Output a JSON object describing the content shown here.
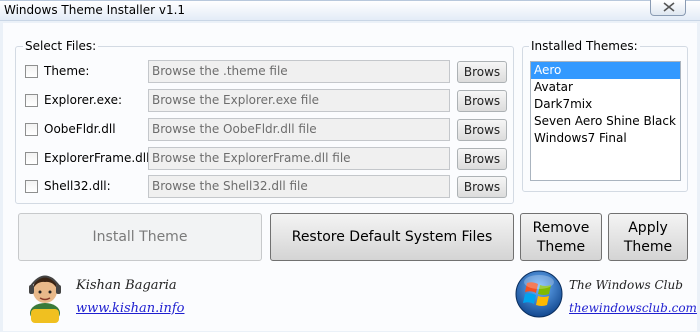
{
  "window": {
    "title": "Windows Theme Installer v1.1"
  },
  "select_files": {
    "label": "Select Files:",
    "rows": [
      {
        "label": "Theme:",
        "placeholder": "Browse the .theme file",
        "button": "Brows"
      },
      {
        "label": "Explorer.exe:",
        "placeholder": "Browse the Explorer.exe file",
        "button": "Brows"
      },
      {
        "label": "OobeFldr.dll",
        "placeholder": "Browse the OobeFldr.dll file",
        "button": "Brows"
      },
      {
        "label": "ExplorerFrame.dll",
        "placeholder": "Browse the ExplorerFrame.dll file",
        "button": "Brows"
      },
      {
        "label": "Shell32.dll:",
        "placeholder": "Browse the Shell32.dll file",
        "button": "Brows"
      }
    ]
  },
  "installed_themes": {
    "label": "Installed Themes:",
    "items": [
      "Aero",
      "Avatar",
      "Dark7mix",
      "Seven Aero Shine Black",
      "Windows7 Final"
    ],
    "selected": "Aero"
  },
  "buttons": {
    "install": "Install Theme",
    "restore": "Restore Default System Files",
    "remove_line1": "Remove",
    "remove_line2": "Theme",
    "apply_line1": "Apply",
    "apply_line2": "Theme"
  },
  "footer": {
    "author_name": "Kishan Bagaria",
    "author_link": "www.kishan.info",
    "partner_name": "The Windows Club",
    "partner_link": "thewindowsclub.com"
  },
  "icons": {
    "close": "close-icon",
    "author": "author-avatar-icon",
    "partner": "windows-logo-icon"
  },
  "colors": {
    "selection": "#3399ff",
    "link": "#1f1fd0",
    "window_bg": "#ebf1f8"
  }
}
